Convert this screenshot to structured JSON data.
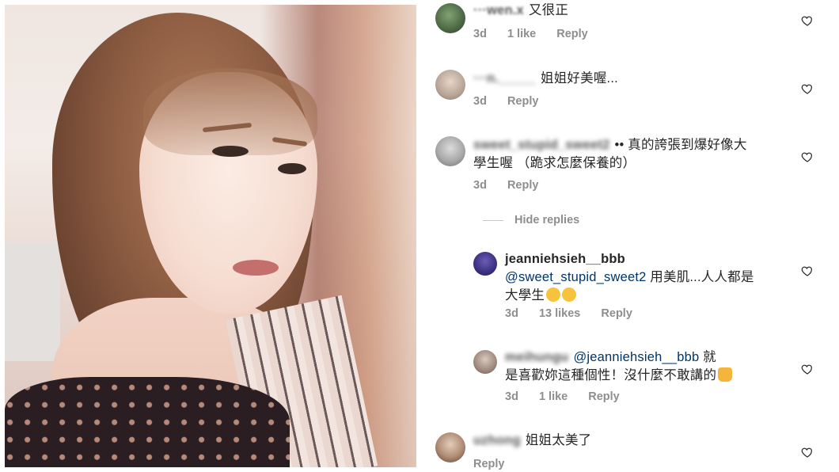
{
  "comments": [
    {
      "user": "wen.x",
      "user_visible": "···wen.x",
      "text": "又很正",
      "time": "3d",
      "likes": "1 like",
      "reply": "Reply"
    },
    {
      "user": "____",
      "user_visible": "···n._____",
      "text": "姐姐好美喔...",
      "time": "3d",
      "reply": "Reply"
    },
    {
      "user": "sweet_stupid_sweet2",
      "text_line1": "•• 真的誇張到爆好像大",
      "text_line2": "學生喔 （跪求怎麼保養的）",
      "time": "3d",
      "reply": "Reply"
    }
  ],
  "hide_replies": "Hide replies",
  "replies": [
    {
      "user": "jeanniehsieh__bbb",
      "mention": "@sweet_stupid_sweet2",
      "text_line1_rest": " 用美肌...人人都是",
      "text_line2": "大學生",
      "time": "3d",
      "likes": "13 likes",
      "reply": "Reply"
    },
    {
      "user": "meihungu",
      "mention": "@jeanniehsieh__bbb",
      "text_line1_rest": " 就",
      "text_line2": "是喜歡妳這種個性！沒什麼不敢講的",
      "time": "3d",
      "likes": "1 like",
      "reply": "Reply"
    }
  ],
  "last_comment": {
    "user": "uzhong",
    "text": "姐姐太美了",
    "reply": "Reply"
  },
  "colors": {
    "text": "#262626",
    "meta": "#8e8e8e",
    "mention": "#003569"
  }
}
